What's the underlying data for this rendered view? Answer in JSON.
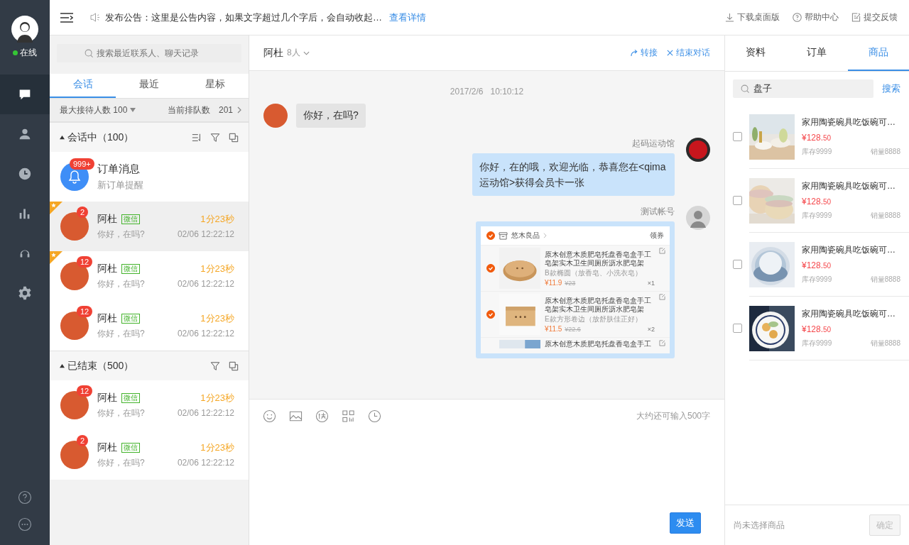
{
  "user": {
    "status": "在线",
    "online": true
  },
  "nav": [
    {
      "selected": true
    },
    {
      "selected": false
    },
    {
      "selected": false
    },
    {
      "selected": false
    },
    {
      "selected": false
    },
    {
      "selected": false
    }
  ],
  "notice": {
    "text": "发布公告：这里是公告内容，如果文字超过几个字后，会自动收起…",
    "link": "查看详情"
  },
  "top_links": [
    "下载桌面版",
    "帮助中心",
    "提交反馈"
  ],
  "contacts": {
    "search_placeholder": "搜索最近联系人、聊天记录",
    "tabs": [
      {
        "label": "会话",
        "selected": true
      },
      {
        "label": "最近",
        "selected": false
      },
      {
        "label": "星标",
        "selected": false
      }
    ],
    "max_label": "最大接待人数 100",
    "queue_label": "当前排队数",
    "queue_value": "201",
    "groups": [
      {
        "title": "会话中（100）",
        "expanded": true,
        "sortable": true,
        "items": [
          {
            "kind": "notice",
            "name": "订单消息",
            "preview": "新订单提醒",
            "badge": "999+"
          },
          {
            "kind": "chat",
            "name": "阿杜",
            "tag": "微信",
            "duration": "1分23秒",
            "preview": "你好，在吗?",
            "time": "02/06 12:22:12",
            "badge": "2",
            "starred": true,
            "selected": true
          },
          {
            "kind": "chat",
            "name": "阿杜",
            "tag": "微信",
            "duration": "1分23秒",
            "preview": "你好，在吗?",
            "time": "02/06 12:22:12",
            "badge": "12",
            "starred": true,
            "selected": false
          },
          {
            "kind": "chat",
            "name": "阿杜",
            "tag": "微信",
            "duration": "1分23秒",
            "preview": "你好，在吗?",
            "time": "02/06 12:22:12",
            "badge": "12",
            "starred": false,
            "selected": false
          }
        ]
      },
      {
        "title": "已结束（500）",
        "expanded": true,
        "sortable": false,
        "items": [
          {
            "kind": "chat",
            "name": "阿杜",
            "tag": "微信",
            "duration": "1分23秒",
            "preview": "你好，在吗?",
            "time": "02/06 12:22:12",
            "badge": "12",
            "starred": false,
            "selected": false
          },
          {
            "kind": "chat",
            "name": "阿杜",
            "tag": "微信",
            "duration": "1分23秒",
            "preview": "你好，在吗?",
            "time": "02/06 12:22:12",
            "badge": "2",
            "starred": false,
            "selected": false
          }
        ]
      }
    ]
  },
  "chat": {
    "name": "阿杜",
    "count": "8人",
    "actions": [
      "转接",
      "结束对话"
    ],
    "messages": [
      {
        "kind": "time",
        "text": "2017/2/6   10:10:12"
      },
      {
        "kind": "incoming",
        "text": "你好，在吗?"
      },
      {
        "kind": "outgoing",
        "sender": "起码运动馆",
        "text": "你好，在的哦，欢迎光临，恭喜您在<qima运动馆>获得会员卡一张"
      },
      {
        "kind": "card",
        "sender": "测试帐号",
        "shop": "悠木良品",
        "shop_checked": true,
        "coupon": "领券",
        "items": [
          {
            "title": "原木创意木质肥皂托盘香皂盒手工皂架实木卫生间厕所沥水肥皂架",
            "variant": "B款椭圆（放香皂、小洗衣皂）",
            "price": "¥11.9",
            "old_price": "¥23",
            "qty": "×1",
            "checked": true
          },
          {
            "title": "原木创意木质肥皂托盘香皂盒手工皂架实木卫生间厕所沥水肥皂架",
            "variant": "E款方形卷边（放舒肤佳正好）",
            "price": "¥11.5",
            "old_price": "¥22.6",
            "qty": "×2",
            "checked": true
          },
          {
            "title": "原木创意木质肥皂托盘香皂盒手工"
          }
        ]
      }
    ],
    "input": {
      "counter": "大约还可输入500字",
      "send": "发送"
    }
  },
  "goods": {
    "tabs": [
      {
        "label": "资料",
        "selected": false
      },
      {
        "label": "订单",
        "selected": false
      },
      {
        "label": "商品",
        "selected": true
      }
    ],
    "search_value": "盘子",
    "search_button": "搜索",
    "products": [
      {
        "title": "家用陶瓷碗具吃饭碗可…",
        "price": "¥128.",
        "cents": "50",
        "stock": "库存9999",
        "sales": "销量8888",
        "checked": false
      },
      {
        "title": "家用陶瓷碗具吃饭碗可…",
        "price": "¥128.",
        "cents": "50",
        "stock": "库存9999",
        "sales": "销量8888",
        "checked": false
      },
      {
        "title": "家用陶瓷碗具吃饭碗可…",
        "price": "¥128.",
        "cents": "50",
        "stock": "库存9999",
        "sales": "销量8888",
        "checked": false
      },
      {
        "title": "家用陶瓷碗具吃饭碗可…",
        "price": "¥128.",
        "cents": "50",
        "stock": "库存9999",
        "sales": "销量8888",
        "checked": false
      }
    ],
    "footer_text": "尚未选择商品",
    "confirm": {
      "label": "确定",
      "disabled": true
    }
  }
}
